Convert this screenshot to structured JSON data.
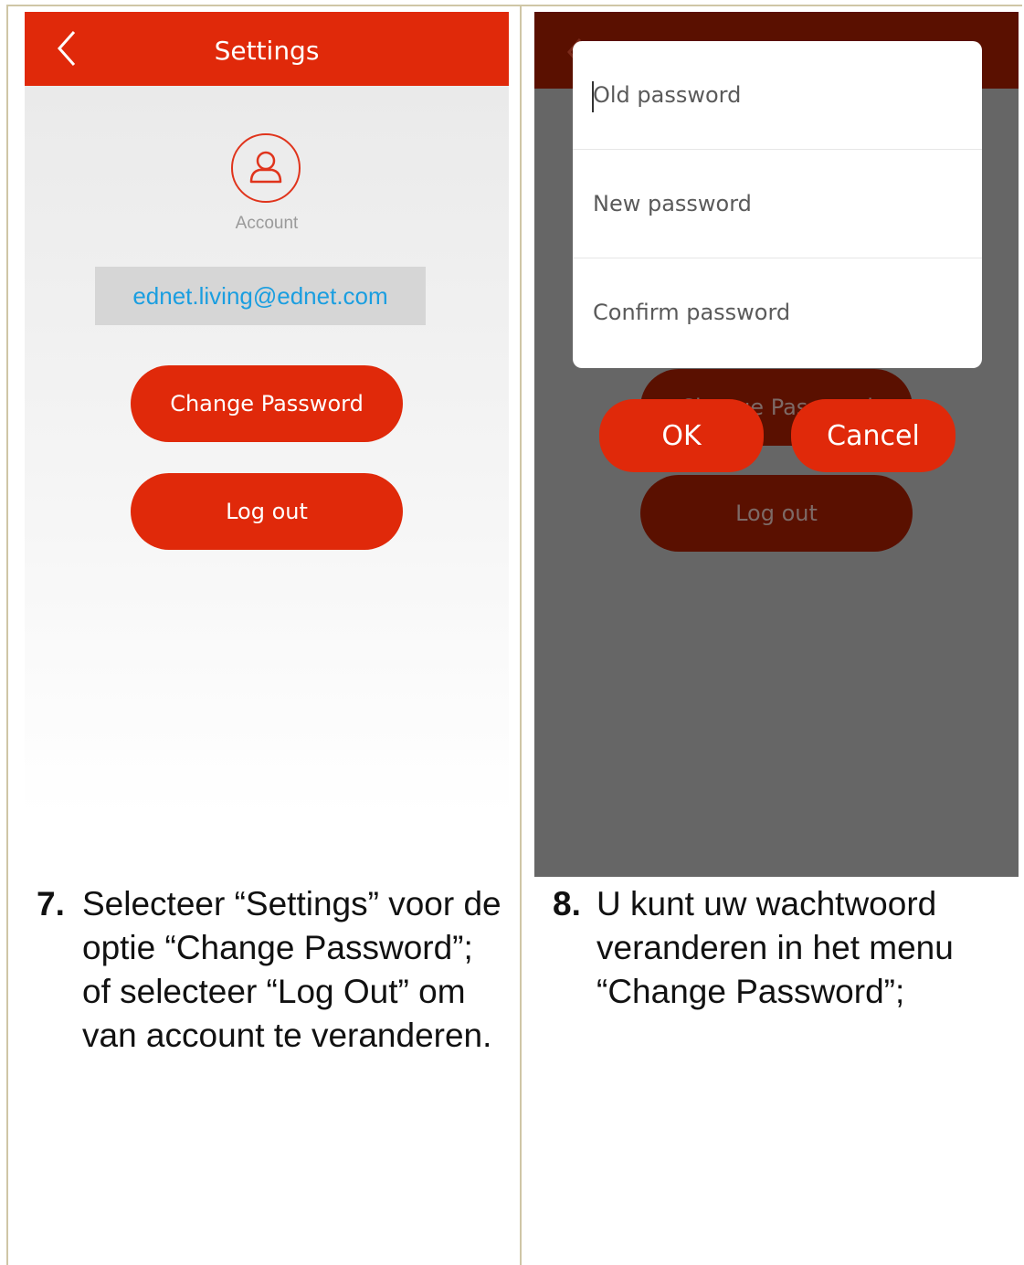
{
  "left_screen": {
    "title": "Settings",
    "account_label": "Account",
    "email": "ednet.living@ednet.com",
    "change_password_label": "Change Password",
    "logout_label": "Log out"
  },
  "right_screen": {
    "dialog": {
      "old_password_placeholder": "Old password",
      "new_password_placeholder": "New password",
      "confirm_password_placeholder": "Confirm password",
      "ok_label": "OK",
      "cancel_label": "Cancel"
    },
    "background_change_password_label": "Change Password",
    "background_logout_label": "Log out"
  },
  "captions": {
    "left": {
      "number": "7.",
      "lines": [
        "Selecteer “Settings” voor de",
        "optie “Change Password”;",
        "of selecteer “Log Out” om",
        "van account te veranderen."
      ]
    },
    "right": {
      "number": "8.",
      "lines": [
        "U kunt uw wachtwoord",
        "veranderen in het menu",
        "“Change Password”;"
      ]
    }
  },
  "icons": {
    "back": "chevron-left-icon",
    "account": "user-icon"
  },
  "colors": {
    "accent": "#e0290a",
    "link": "#1a9ee0",
    "overlay": "#666666",
    "dimmed_accent": "#5a1000"
  }
}
